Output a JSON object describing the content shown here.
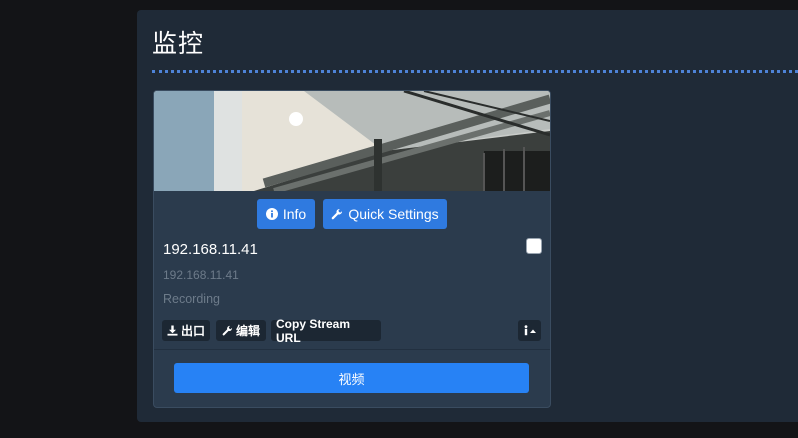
{
  "page": {
    "title": "监控"
  },
  "camera_card": {
    "buttons": {
      "info_label": "Info",
      "quick_settings_label": "Quick Settings"
    },
    "name": "192.168.11.41",
    "address": "192.168.11.41",
    "status": "Recording",
    "actions": {
      "export_label": "出口",
      "edit_label": "编辑",
      "copy_stream_label": "Copy Stream URL"
    },
    "video_button_label": "视频",
    "selected": false
  },
  "colors": {
    "background": "#131417",
    "panel": "#1f2a37",
    "card": "#2b3b4d",
    "accent_blue": "#2f7ae0",
    "video_blue": "#2782f5",
    "divider_dots": "#4e83d8"
  },
  "icons": {
    "info": "info-circle-icon",
    "quick_settings": "wrench-icon",
    "export": "download-icon",
    "edit": "wrench-icon",
    "details_toggle": "info-caret-icon"
  }
}
